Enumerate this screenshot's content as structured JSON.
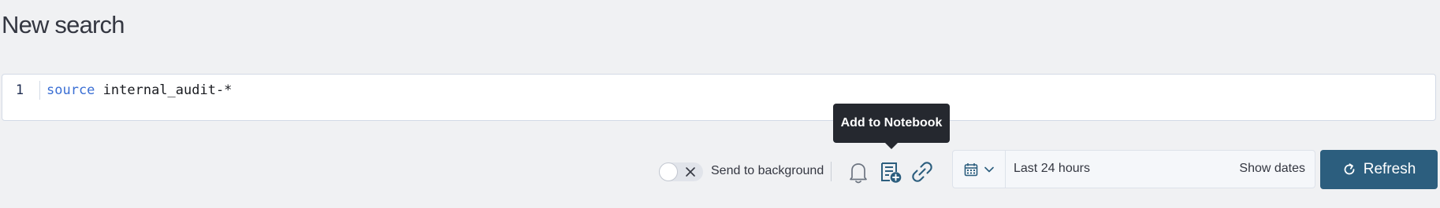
{
  "page": {
    "title": "New search"
  },
  "editor": {
    "line_number": "1",
    "keyword": "source",
    "query_rest": " internal_audit-*"
  },
  "tooltip": {
    "text": "Add to Notebook"
  },
  "background_toggle": {
    "label": "Send to background",
    "state": "off"
  },
  "icons": {
    "toggle": "close-icon",
    "alert": "bell-icon",
    "notebook": "notebook-add-icon",
    "share": "link-icon",
    "calendar": "calendar-icon",
    "quick_menu_caret": "chevron-down-icon",
    "refresh": "refresh-icon"
  },
  "date_picker": {
    "range": "Last 24 hours",
    "show_dates": "Show dates"
  },
  "refresh_button": {
    "label": "Refresh"
  },
  "colors": {
    "keyword": "#3b6fd4",
    "primary_button": "#2c5e7e",
    "tooltip_background": "#25282f",
    "page_background": "#f0f1f3"
  }
}
